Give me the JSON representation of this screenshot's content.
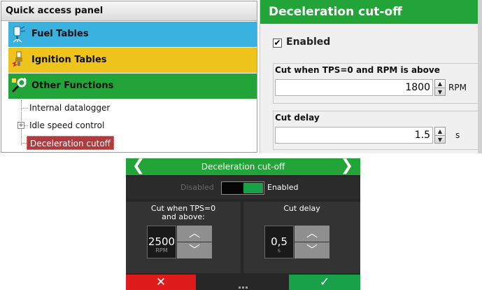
{
  "quick_access": {
    "title": "Quick access panel",
    "categories": [
      {
        "label": "Fuel Tables",
        "color": "#3ab2e0",
        "icon": "fuel-injector-icon"
      },
      {
        "label": "Ignition Tables",
        "color": "#eec31c",
        "icon": "spark-plug-icon"
      },
      {
        "label": "Other Functions",
        "color": "#23a438",
        "icon": "functions-icon"
      }
    ],
    "tree": [
      {
        "label": "Internal datalogger",
        "expandable": false,
        "selected": false
      },
      {
        "label": "Idle speed control",
        "expandable": true,
        "expander": "+",
        "selected": false
      },
      {
        "label": "Deceleration cutoff",
        "expandable": false,
        "selected": true
      }
    ]
  },
  "decel_panel": {
    "title": "Deceleration cut-off",
    "title_color": "#23a438",
    "enabled_label": "Enabled",
    "enabled_checked": true,
    "check_mark": "✔",
    "rpm_group": {
      "label": "Cut when TPS=0 and RPM is above",
      "value": "1800",
      "unit": "RPM"
    },
    "delay_group": {
      "label": "Cut delay",
      "value": "1.5",
      "unit": "s"
    },
    "spin_up": "▲",
    "spin_down": "▼"
  },
  "device": {
    "title": "Deceleration cut-off",
    "prev_arrow": "❮",
    "next_arrow": "❯",
    "disabled_label": "Disabled",
    "enabled_label": "Enabled",
    "toggle_on": true,
    "rpm_panel": {
      "label": "Cut when TPS=0 and above:",
      "value": "2500",
      "unit": "RPM"
    },
    "delay_panel": {
      "label": "Cut delay",
      "value": "0,5",
      "unit": "s"
    },
    "up_glyph": "︿",
    "down_glyph": "﹀",
    "cancel_glyph": "✕",
    "ok_glyph": "✓",
    "colors": {
      "cancel": "#e01b1b",
      "ok": "#19a14a",
      "header": "#23a438"
    }
  }
}
